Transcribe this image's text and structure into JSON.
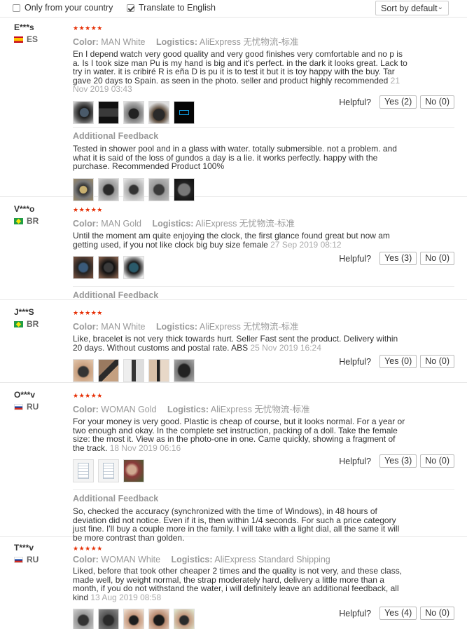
{
  "filters": {
    "only_country": {
      "label": "Only from your country",
      "checked": false
    },
    "translate": {
      "label": "Translate to English",
      "checked": true
    },
    "sort_label": "Sort by default"
  },
  "labels": {
    "color": "Color:",
    "logistics": "Logistics:",
    "helpful": "Helpful?",
    "additional": "Additional Feedback"
  },
  "colors": {
    "star": "#e62e04",
    "muted": "#999999"
  },
  "reviews": [
    {
      "user": "E***s",
      "country": "ES",
      "stars": "★★★★★",
      "rating": 5,
      "color": "MAN White",
      "logistics": "AliExpress 无忧物流-标准",
      "text": "En I depend watch very good quality and very good finishes very comfortable and no p is a. Is I took size man Pu is my hand is big and it's perfect. in the dark it looks great. Lack to try in water. it is cribiré R is eña D is pu it is to test it but it is toy happy with the buy. Tar gave 20 days to Spain. as seen in the photo. seller and product highly recommended",
      "date": "21 Nov 2019 03:43",
      "yes": "Yes (2)",
      "no": "No (0)",
      "additional_text": "Tested in shower pool and in a glass with water. totally submersible. not a problem. and what it is said of the loss of gundos a day is a lie. it works perfectly. happy with the purchase. Recommended Product 100%"
    },
    {
      "user": "V***o",
      "country": "BR",
      "stars": "★★★★★",
      "rating": 5,
      "color": "MAN Gold",
      "logistics": "AliExpress 无忧物流-标准",
      "text": "Until the moment am quite enjoying the clock, the first glance found great but now am getting used, if you not like clock big buy size female",
      "date": "27 Sep 2019 08:12",
      "yes": "Yes (3)",
      "no": "No (0)"
    },
    {
      "user": "J***S",
      "country": "BR",
      "stars": "★★★★★",
      "rating": 5,
      "color": "MAN White",
      "logistics": "AliExpress 无忧物流-标准",
      "text": "Like, bracelet is not very thick towards hurt. Seller Fast sent the product. Delivery within 20 days. Without customs and postal rate. ABS",
      "date": "25 Nov 2019 16:24",
      "yes": "Yes (0)",
      "no": "No (0)"
    },
    {
      "user": "O***v",
      "country": "RU",
      "stars": "★★★★★",
      "rating": 5,
      "color": "WOMAN Gold",
      "logistics": "AliExpress 无忧物流-标准",
      "text": "For your money is very good. Plastic is cheap of course, but it looks normal. For a year or two enough and okay. In the complete set instruction, packing of a doll. Take the female size: the most it. View as in the photo-one in one. Came quickly, showing a fragment of the track.",
      "date": "18 Nov 2019 06:16",
      "yes": "Yes (3)",
      "no": "No (0)",
      "additional_text": "So, checked the accuracy (synchronized with the time of Windows), in 48 hours of deviation did not notice. Even if it is, then within 1/4 seconds. For such a price category just fine. I'll buy a couple more in the family. I will take with a light dial, all the same it will be more contrast than golden."
    },
    {
      "user": "T***v",
      "country": "RU",
      "stars": "★★★★★",
      "rating": 5,
      "color": "WOMAN White",
      "logistics": "AliExpress Standard Shipping",
      "text": "Liked, before that took other cheaper 2 times and the quality is not very, and these class, made well, by weight normal, the strap moderately hard, delivery a little more than a month, if you do not withstand the water, i will definitely leave an additional feedback, all kind",
      "date": "13 Aug 2019 08:58",
      "yes": "Yes (4)",
      "no": "No (0)"
    }
  ]
}
